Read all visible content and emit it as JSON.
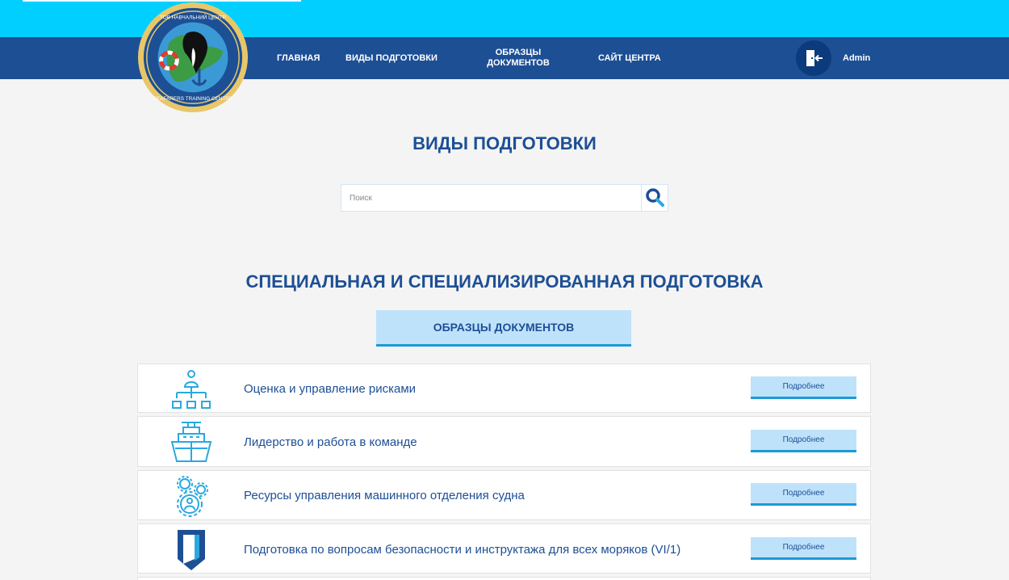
{
  "header": {
    "logo_text": "ТОВ НАВЧАЛЬНИЙ ЦЕНТР ФАХІВЦІВ МОРСЬКОГО ТРАНСПОРТУ · SEAFARERS TRAINING CENTRE",
    "nav": {
      "home": "ГЛАВНАЯ",
      "training_types": "ВИДЫ ПОДГОТОВКИ",
      "doc_samples_line1": "ОБРАЗЦЫ",
      "doc_samples_line2": "ДОКУМЕНТОВ",
      "center_site": "САЙТ ЦЕНТРА"
    },
    "user": {
      "name": "Admin",
      "icon": "logout-door-icon"
    }
  },
  "main": {
    "page_title": "ВИДЫ ПОДГОТОВКИ",
    "search": {
      "placeholder": "Поиск",
      "value": "",
      "icon": "search-icon"
    },
    "section_title": "СПЕЦИАЛЬНАЯ И СПЕЦИАЛИЗИРОВАННАЯ ПОДГОТОВКА",
    "docs_button": "ОБРАЗЦЫ ДОКУМЕНТОВ",
    "courses": [
      {
        "title": "Оценка и управление рисками",
        "button": "Подробнее",
        "icon": "org-hierarchy-icon"
      },
      {
        "title": "Лидерство и работа в команде",
        "button": "Подробнее",
        "icon": "ship-icon"
      },
      {
        "title": "Ресурсы управления машинного отделения судна",
        "button": "Подробнее",
        "icon": "gears-person-icon"
      },
      {
        "title": "Подготовка по вопросам безопасности и инструктажа для всех моряков (VI/1)",
        "button": "Подробнее",
        "icon": "shield-icon"
      }
    ]
  },
  "colors": {
    "top_band": "#00cfff",
    "navbar": "#1d4f95",
    "accent_blue": "#1c9ad6",
    "button_bg": "#bfe2fb",
    "icon_blue": "#29a9e0",
    "page_bg": "#f4f4f4"
  }
}
